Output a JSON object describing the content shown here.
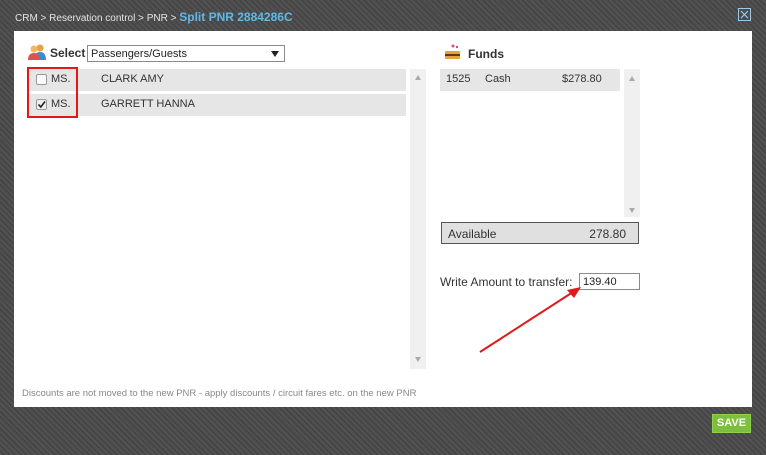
{
  "breadcrumb": {
    "path": "CRM > Reservation control > PNR > ",
    "current": "Split PNR 2884286C"
  },
  "passengers": {
    "select_label": "Select",
    "dropdown_value": "Passengers/Guests",
    "rows": [
      {
        "title": "MS.",
        "name": "CLARK AMY",
        "checked": false
      },
      {
        "title": "MS.",
        "name": "GARRETT HANNA",
        "checked": true
      }
    ]
  },
  "funds": {
    "label": "Funds",
    "rows": [
      {
        "id": "1525",
        "type": "Cash",
        "amount": "$278.80"
      }
    ],
    "available_label": "Available",
    "available_value": "278.80",
    "transfer_label": "Write Amount to transfer:",
    "transfer_value": "139.40"
  },
  "footer": {
    "note": "Discounts are not moved to the new PNR - apply discounts / circuit fares etc. on the new PNR",
    "save_label": "SAVE"
  },
  "colors": {
    "accent_blue": "#63b7e6",
    "save_green": "#7bbf3a",
    "annotation_red": "#e01a1a"
  }
}
